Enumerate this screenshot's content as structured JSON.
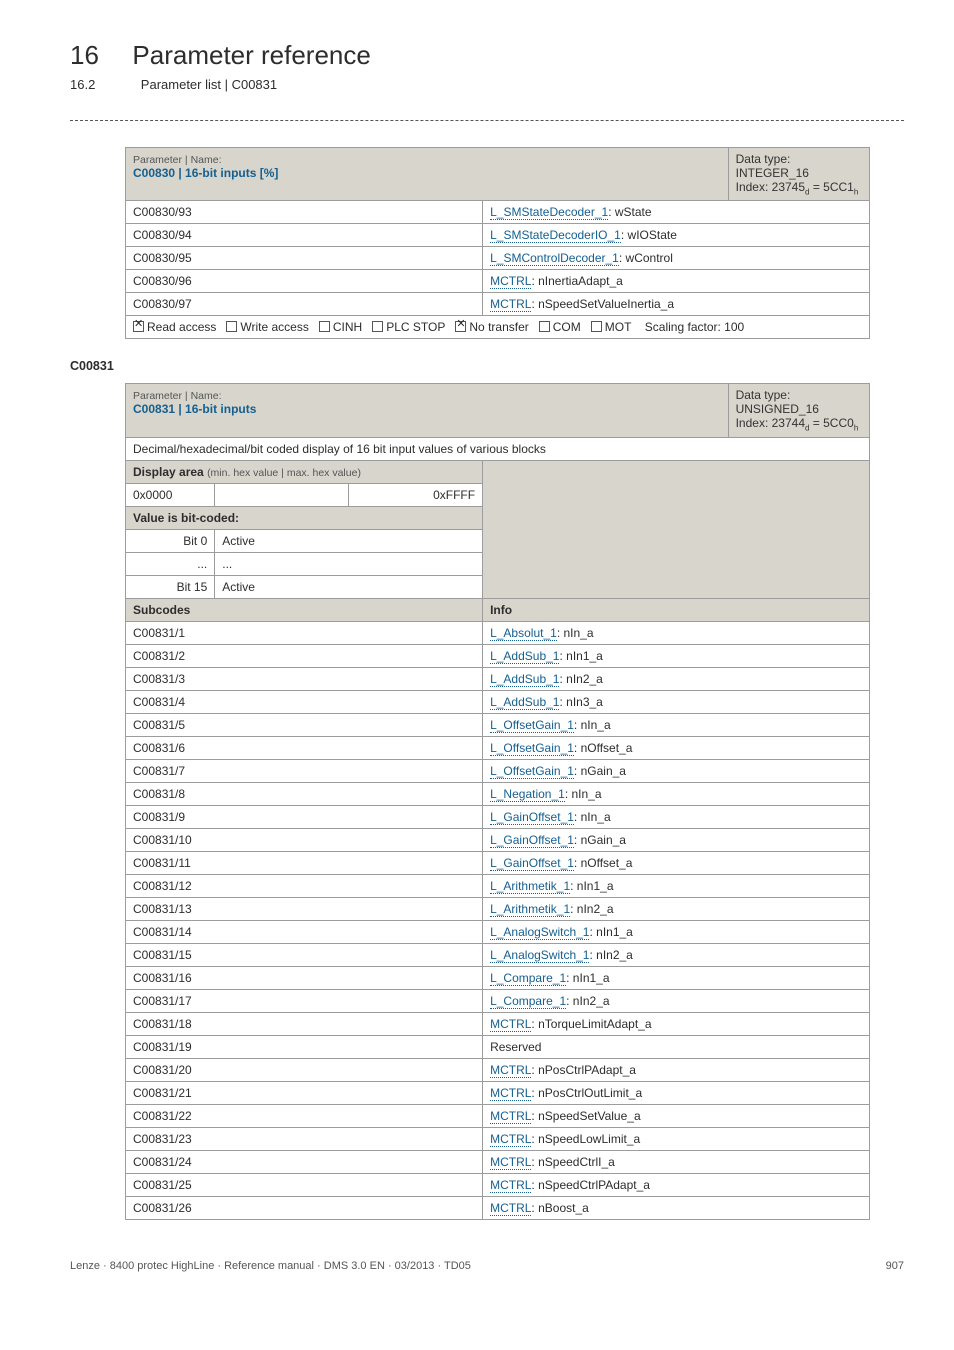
{
  "header": {
    "chapnum": "16",
    "chaptitle": "Parameter reference",
    "subnum": "16.2",
    "subtitle": "Parameter list | C00831"
  },
  "table1": {
    "param_label": "Parameter | Name:",
    "param_code": "C00830 | 16-bit inputs [%]",
    "meta_line1": "Data type: INTEGER_16",
    "meta_line2_prefix": "Index: 23745",
    "meta_line2_sub1": "d",
    "meta_line2_mid": " = 5CC1",
    "meta_line2_sub2": "h",
    "rows": [
      {
        "c": "C00830/93",
        "link": "L_SMStateDecoder_1",
        "rest": ": wState"
      },
      {
        "c": "C00830/94",
        "link": "L_SMStateDecoderIO_1",
        "rest": ": wIOState"
      },
      {
        "c": "C00830/95",
        "link": "L_SMControlDecoder_1",
        "rest": ": wControl"
      },
      {
        "c": "C00830/96",
        "link": "MCTRL",
        "rest": ": nInertiaAdapt_a"
      },
      {
        "c": "C00830/97",
        "link": "MCTRL",
        "rest": ": nSpeedSetValueInertia_a"
      }
    ],
    "footer": {
      "read": "Read access",
      "write": "Write access",
      "cinh": "CINH",
      "plc": "PLC STOP",
      "notx": "No transfer",
      "com": "COM",
      "mot": "MOT",
      "scale": "Scaling factor: 100"
    }
  },
  "section_c00831": "C00831",
  "table2": {
    "param_label": "Parameter | Name:",
    "param_code": "C00831 | 16-bit inputs",
    "meta_line1": "Data type: UNSIGNED_16",
    "meta_line2_prefix": "Index: 23744",
    "meta_line2_sub1": "d",
    "meta_line2_mid": " = 5CC0",
    "meta_line2_sub2": "h",
    "desc": "Decimal/hexadecimal/bit coded display of 16 bit input values of various blocks",
    "display_area_label": "Display area",
    "display_area_note": "(min. hex value | max. hex value)",
    "hex_min": "0x0000",
    "hex_max": "0xFFFF",
    "bitcoded_label": "Value is bit-coded:",
    "bit0": "Bit 0",
    "bit0_val": "Active",
    "dots": "...",
    "bit15": "Bit 15",
    "bit15_val": "Active",
    "subcodes": "Subcodes",
    "info": "Info",
    "rows": [
      {
        "c": "C00831/1",
        "link": "L_Absolut_1",
        "rest": ": nIn_a"
      },
      {
        "c": "C00831/2",
        "link": "L_AddSub_1",
        "rest": ": nIn1_a"
      },
      {
        "c": "C00831/3",
        "link": "L_AddSub_1",
        "rest": ": nIn2_a"
      },
      {
        "c": "C00831/4",
        "link": "L_AddSub_1",
        "rest": ": nIn3_a"
      },
      {
        "c": "C00831/5",
        "link": "L_OffsetGain_1",
        "rest": ": nIn_a"
      },
      {
        "c": "C00831/6",
        "link": "L_OffsetGain_1",
        "rest": ": nOffset_a"
      },
      {
        "c": "C00831/7",
        "link": "L_OffsetGain_1",
        "rest": ": nGain_a"
      },
      {
        "c": "C00831/8",
        "link": "L_Negation_1",
        "rest": ": nIn_a"
      },
      {
        "c": "C00831/9",
        "link": "L_GainOffset_1",
        "rest": ": nIn_a"
      },
      {
        "c": "C00831/10",
        "link": "L_GainOffset_1",
        "rest": ": nGain_a"
      },
      {
        "c": "C00831/11",
        "link": "L_GainOffset_1",
        "rest": ": nOffset_a"
      },
      {
        "c": "C00831/12",
        "link": "L_Arithmetik_1",
        "rest": ": nIn1_a"
      },
      {
        "c": "C00831/13",
        "link": "L_Arithmetik_1",
        "rest": ": nIn2_a"
      },
      {
        "c": "C00831/14",
        "link": "L_AnalogSwitch_1",
        "rest": ": nIn1_a"
      },
      {
        "c": "C00831/15",
        "link": "L_AnalogSwitch_1",
        "rest": ": nIn2_a"
      },
      {
        "c": "C00831/16",
        "link": "L_Compare_1",
        "rest": ": nIn1_a"
      },
      {
        "c": "C00831/17",
        "link": "L_Compare_1",
        "rest": ": nIn2_a"
      },
      {
        "c": "C00831/18",
        "link": "MCTRL",
        "rest": ": nTorqueLimitAdapt_a"
      },
      {
        "c": "C00831/19",
        "plain": "Reserved"
      },
      {
        "c": "C00831/20",
        "link": "MCTRL",
        "rest": ": nPosCtrlPAdapt_a"
      },
      {
        "c": "C00831/21",
        "link": "MCTRL",
        "rest": ": nPosCtrlOutLimit_a"
      },
      {
        "c": "C00831/22",
        "link": "MCTRL",
        "rest": ": nSpeedSetValue_a"
      },
      {
        "c": "C00831/23",
        "link": "MCTRL",
        "rest": ": nSpeedLowLimit_a"
      },
      {
        "c": "C00831/24",
        "link": "MCTRL",
        "rest": ": nSpeedCtrlI_a"
      },
      {
        "c": "C00831/25",
        "link": "MCTRL",
        "rest": ": nSpeedCtrlPAdapt_a"
      },
      {
        "c": "C00831/26",
        "link": "MCTRL",
        "rest": ": nBoost_a"
      }
    ]
  },
  "footer": {
    "left": "Lenze · 8400 protec HighLine · Reference manual · DMS 3.0 EN · 03/2013 · TD05",
    "right": "907"
  }
}
